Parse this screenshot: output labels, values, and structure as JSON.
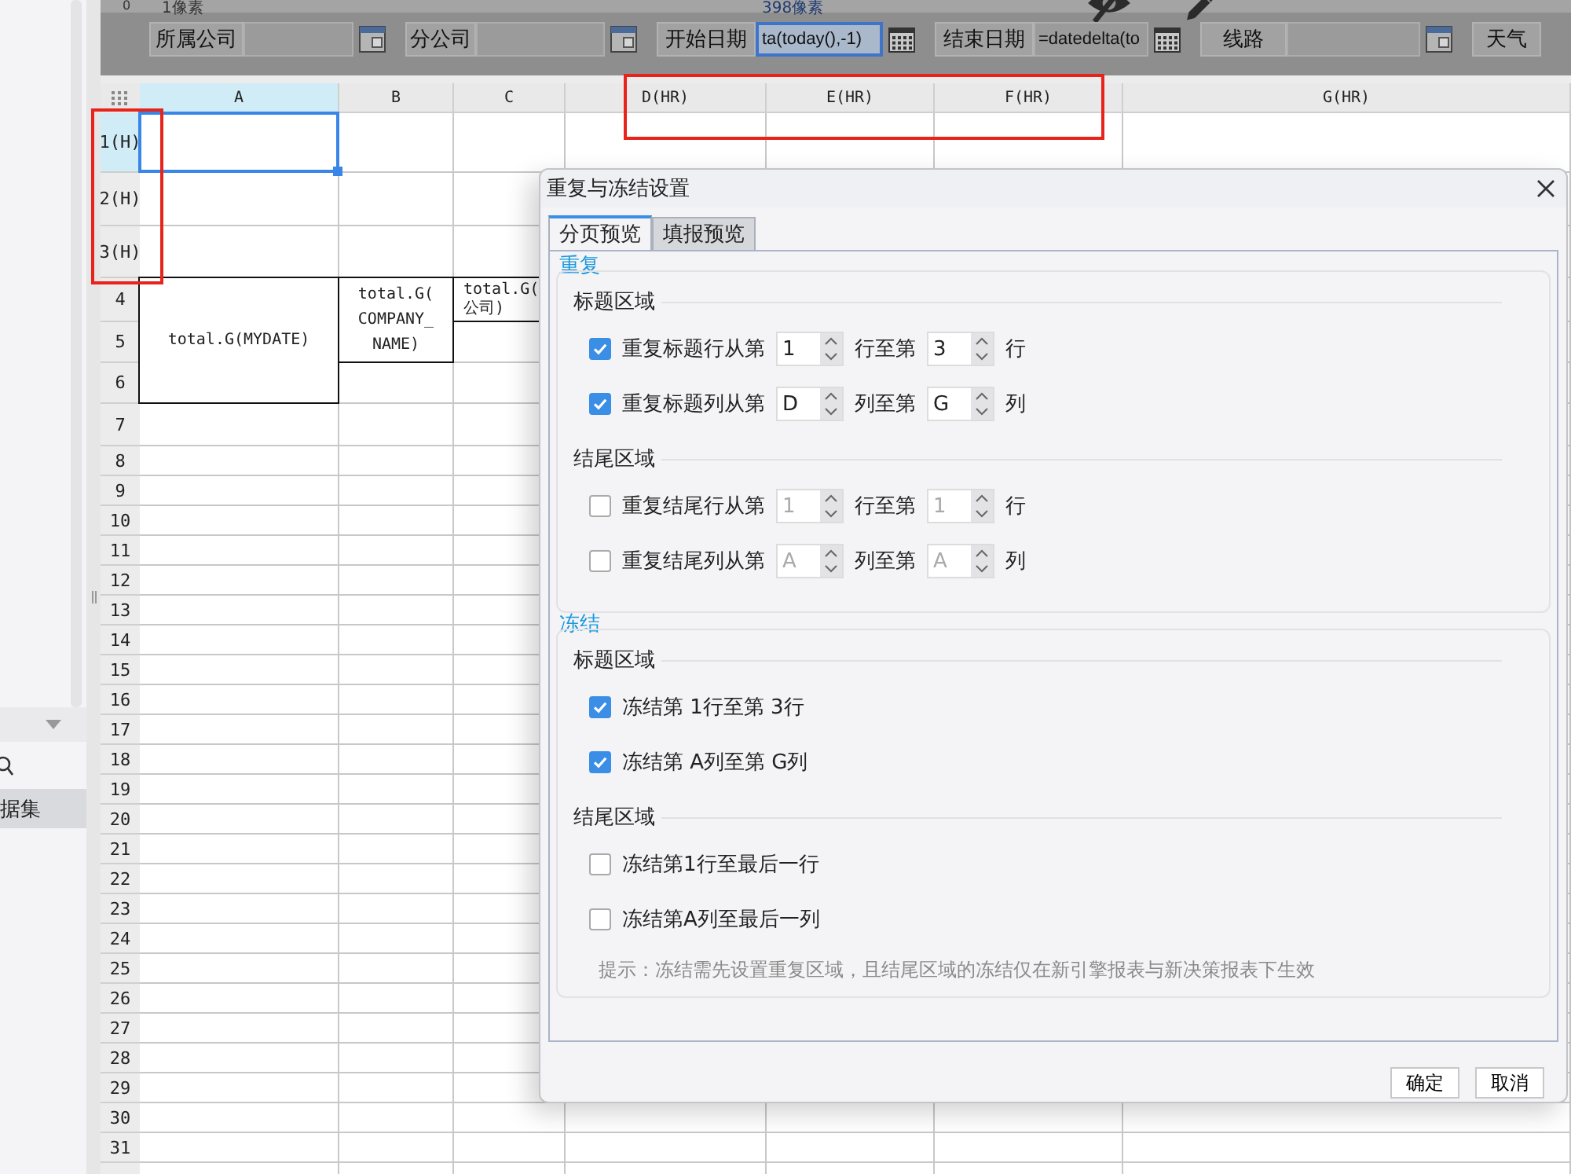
{
  "sidebar": {
    "items": [
      {
        "label": "据集",
        "selected": true
      }
    ]
  },
  "ruler": {
    "mark": "0"
  },
  "params": [
    {
      "kind": "combo",
      "label": "所属公司",
      "size_hint": "1像素",
      "selected": false
    },
    {
      "kind": "combo",
      "label": "分公司",
      "selected": false
    },
    {
      "kind": "date",
      "label": "开始日期",
      "value": "ta(today(),-1)",
      "size_hint": "398像素",
      "selected": true
    },
    {
      "kind": "date",
      "label": "结束日期",
      "value": "=datedelta(to",
      "selected": false
    },
    {
      "kind": "combo",
      "label": "线路",
      "selected": false
    },
    {
      "kind": "label",
      "label": "天气"
    }
  ],
  "sheet": {
    "columns": [
      {
        "label": "A",
        "selected": true
      },
      {
        "label": "B",
        "selected": false
      },
      {
        "label": "C",
        "selected": false
      },
      {
        "label": "D(HR)",
        "selected": false
      },
      {
        "label": "E(HR)",
        "selected": false
      },
      {
        "label": "F(HR)",
        "selected": false
      },
      {
        "label": "G(HR)",
        "selected": false
      }
    ],
    "rows": [
      {
        "label": "1(H)",
        "selected": true
      },
      {
        "label": "2(H)",
        "selected": false
      },
      {
        "label": "3(H)",
        "selected": false
      },
      {
        "label": "4",
        "selected": false
      },
      {
        "label": "5",
        "selected": false
      },
      {
        "label": "6",
        "selected": false
      },
      {
        "label": "7",
        "selected": false
      },
      {
        "label": "8",
        "selected": false
      },
      {
        "label": "9",
        "selected": false
      },
      {
        "label": "10",
        "selected": false
      },
      {
        "label": "11",
        "selected": false
      },
      {
        "label": "12",
        "selected": false
      },
      {
        "label": "13",
        "selected": false
      },
      {
        "label": "14",
        "selected": false
      },
      {
        "label": "15",
        "selected": false
      },
      {
        "label": "16",
        "selected": false
      },
      {
        "label": "17",
        "selected": false
      },
      {
        "label": "18",
        "selected": false
      },
      {
        "label": "19",
        "selected": false
      },
      {
        "label": "20",
        "selected": false
      },
      {
        "label": "21",
        "selected": false
      },
      {
        "label": "22",
        "selected": false
      },
      {
        "label": "23",
        "selected": false
      },
      {
        "label": "24",
        "selected": false
      },
      {
        "label": "25",
        "selected": false
      },
      {
        "label": "26",
        "selected": false
      },
      {
        "label": "27",
        "selected": false
      },
      {
        "label": "28",
        "selected": false
      },
      {
        "label": "29",
        "selected": false
      },
      {
        "label": "30",
        "selected": false
      },
      {
        "label": "31",
        "selected": false
      }
    ],
    "cells": [
      {
        "text": "total.G(MYDATE)"
      },
      {
        "text": "total.G(COMPANY_NAME)"
      },
      {
        "text": "total.G(公司)"
      }
    ]
  },
  "dialog": {
    "title": "重复与冻结设置",
    "tabs": [
      {
        "label": "分页预览",
        "selected": true
      },
      {
        "label": "填报预览",
        "selected": false
      }
    ],
    "sections": [
      {
        "title": "重复",
        "groups": [
          {
            "title": "标题区域",
            "rows": [
              {
                "kind": "range",
                "checked": true,
                "label": "重复标题行从第",
                "from": "1",
                "middle": "行至第",
                "to": "3",
                "end": "行"
              },
              {
                "kind": "range",
                "checked": true,
                "label": "重复标题列从第",
                "from": "D",
                "middle": "列至第",
                "to": "G",
                "end": "列"
              }
            ]
          },
          {
            "title": "结尾区域",
            "rows": [
              {
                "kind": "range",
                "checked": false,
                "label": "重复结尾行从第",
                "from": "1",
                "middle": "行至第",
                "to": "1",
                "end": "行"
              },
              {
                "kind": "range",
                "checked": false,
                "label": "重复结尾列从第",
                "from": "A",
                "middle": "列至第",
                "to": "A",
                "end": "列"
              }
            ]
          }
        ]
      },
      {
        "title": "冻结",
        "groups": [
          {
            "title": "标题区域",
            "rows": [
              {
                "kind": "text",
                "checked": true,
                "label": "冻结第 1行至第 3行"
              },
              {
                "kind": "text",
                "checked": true,
                "label": "冻结第 A列至第 G列"
              }
            ]
          },
          {
            "title": "结尾区域",
            "rows": [
              {
                "kind": "text",
                "checked": false,
                "label": "冻结第1行至最后一行"
              },
              {
                "kind": "text",
                "checked": false,
                "label": "冻结第A列至最后一列"
              }
            ]
          }
        ],
        "hint": "提示：冻结需先设置重复区域，且结尾区域的冻结仅在新引擎报表与新决策报表下生效"
      }
    ],
    "buttons": [
      "确定",
      "取消"
    ]
  }
}
